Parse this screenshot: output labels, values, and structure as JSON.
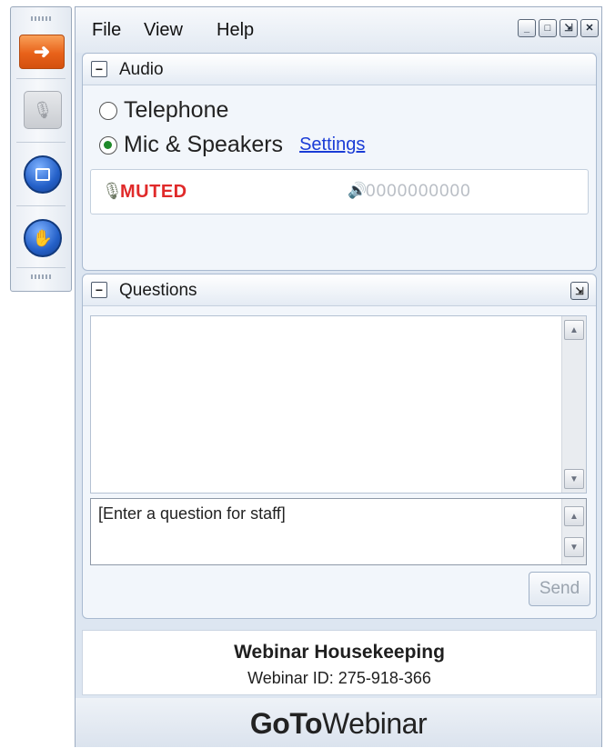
{
  "toolbar": {
    "icons": [
      "arrow-right-icon",
      "microphone-icon",
      "screen-icon",
      "raise-hand-icon"
    ]
  },
  "menu": {
    "file": "File",
    "view": "View",
    "help": "Help"
  },
  "window_controls": {
    "minimize": "_",
    "restore": "□",
    "popout": "⇲",
    "close": "✕"
  },
  "audio": {
    "title": "Audio",
    "options": [
      {
        "label": "Telephone",
        "selected": false
      },
      {
        "label": "Mic & Speakers",
        "selected": true
      }
    ],
    "settings_link": "Settings",
    "status": "MUTED",
    "level_meter": "0000000000"
  },
  "questions": {
    "title": "Questions",
    "input_placeholder": "[Enter a question for staff]",
    "send_label": "Send"
  },
  "info": {
    "title": "Webinar Housekeeping",
    "webinar_id": "Webinar ID: 275-918-366"
  },
  "brand": {
    "bold": "GoTo",
    "regular": "Webinar"
  },
  "colors": {
    "muted_red": "#e02a2a",
    "link_blue": "#1a3cd6",
    "accent_orange": "#e8621a"
  }
}
